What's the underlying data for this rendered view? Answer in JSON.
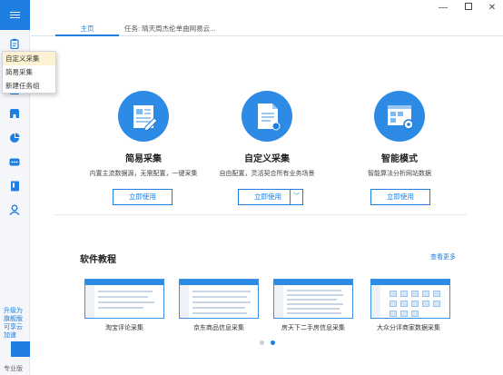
{
  "sidebar": {
    "menu_icon": "hamburger-icon",
    "icons": [
      "clipboard-icon",
      "template-icon",
      "store-icon",
      "pie-chart-icon",
      "message-icon",
      "book-icon",
      "user-icon"
    ],
    "upgrade_text": "升级为旗舰版可享云加速",
    "user_text": "专业版"
  },
  "menu": {
    "items": [
      "自定义采集",
      "简易采集",
      "新建任务组"
    ]
  },
  "tabs": {
    "home": "主页",
    "task": "任务: 晴天周杰伦单曲网易云..."
  },
  "window_controls": [
    "minimize-icon",
    "maximize-icon",
    "close-icon"
  ],
  "features": [
    {
      "title": "简易采集",
      "desc": "内置主流数据源，无需配置，一键采集",
      "button": "立即使用"
    },
    {
      "title": "自定义采集",
      "desc": "自由配置，灵活契合所有业务场景",
      "button": "立即使用"
    },
    {
      "title": "智能模式",
      "desc": "智能算法分析网站数据",
      "button": "立即使用"
    }
  ],
  "tutorials": {
    "title": "软件教程",
    "more": "查看更多",
    "items": [
      "淘宝评论采集",
      "京东商品信息采集",
      "房天下二手房信息采集",
      "大众分评商家数据采集"
    ]
  },
  "carousel": {
    "pages": 2,
    "active": 2
  },
  "colors": {
    "accent": "#1e7fe0",
    "icon_bg": "#2d8be6",
    "menu_highlight": "#fdf3d3"
  }
}
